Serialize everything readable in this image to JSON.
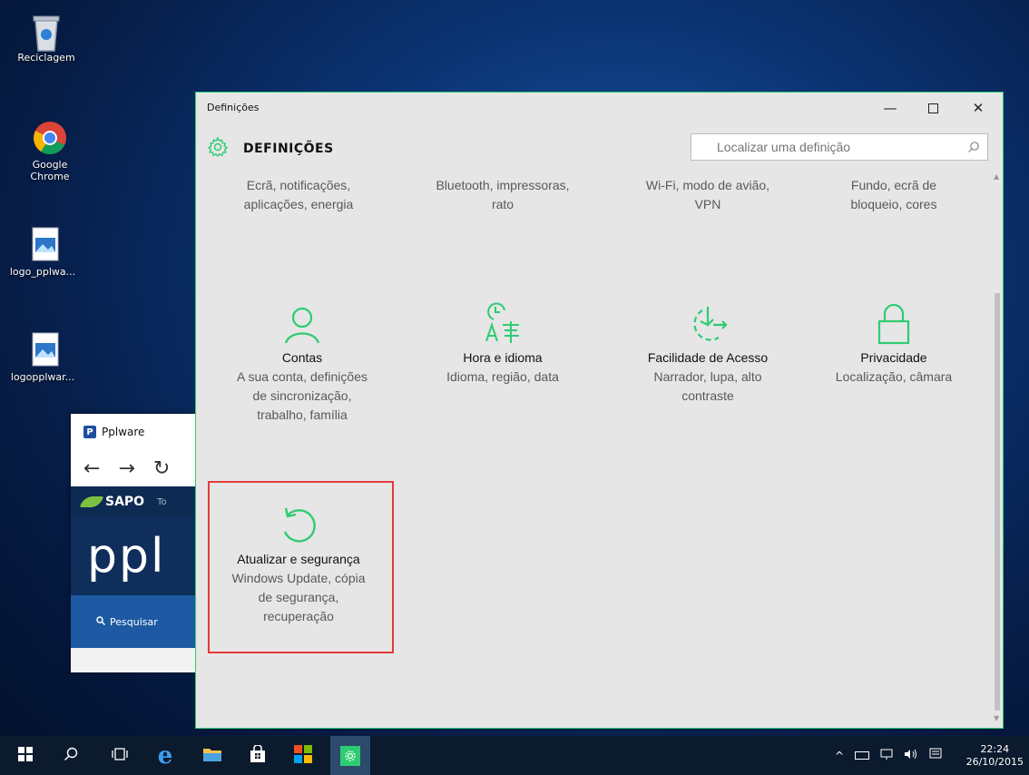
{
  "desktop": {
    "icons": [
      {
        "label": "Reciclagem",
        "icon": "recycle-bin-icon"
      },
      {
        "label": "Google Chrome",
        "icon": "chrome-icon"
      },
      {
        "label": "logo_pplwa...",
        "icon": "image-file-icon"
      },
      {
        "label": "logopplwar...",
        "icon": "image-file-icon"
      }
    ]
  },
  "bg_browser": {
    "title": "Pplware",
    "sapo_label": "SAPO",
    "sapo_trail": "To",
    "brand_text": "ppl",
    "search_label": "Pesquisar"
  },
  "settings_window": {
    "window_title": "Definições",
    "header_title": "DEFINIÇÕES",
    "search_placeholder": "Localizar uma definição",
    "partial_row": [
      {
        "line1": "Ecrã, notificações,",
        "line2": "aplicações, energia"
      },
      {
        "line1": "Bluetooth, impressoras,",
        "line2": "rato"
      },
      {
        "line1": "Wi-Fi, modo de avião,",
        "line2": "VPN"
      },
      {
        "line1": "Fundo, ecrã de",
        "line2": "bloqueio, cores"
      }
    ],
    "tiles": [
      {
        "name": "Contas",
        "desc1": "A sua conta, definições",
        "desc2": "de sincronização,",
        "desc3": "trabalho, família",
        "icon": "person-icon"
      },
      {
        "name": "Hora e idioma",
        "desc1": "Idioma, região, data",
        "desc2": "",
        "desc3": "",
        "icon": "time-language-icon"
      },
      {
        "name": "Facilidade de Acesso",
        "desc1": "Narrador, lupa, alto",
        "desc2": "contraste",
        "desc3": "",
        "icon": "ease-of-access-icon"
      },
      {
        "name": "Privacidade",
        "desc1": "Localização, câmara",
        "desc2": "",
        "desc3": "",
        "icon": "lock-icon"
      },
      {
        "name": "Atualizar e segurança",
        "desc1": "Windows Update, cópia",
        "desc2": "de segurança,",
        "desc3": "recuperação",
        "icon": "update-icon"
      }
    ],
    "accent_color": "#2ecc71",
    "highlight_color": "#e33a3a"
  },
  "taskbar": {
    "time": "22:24",
    "date": "26/10/2015"
  }
}
